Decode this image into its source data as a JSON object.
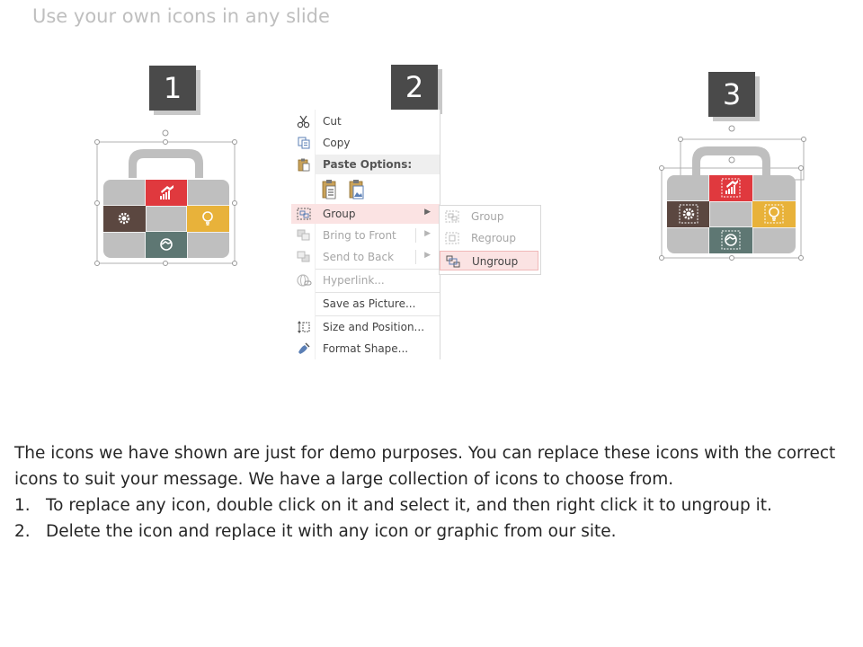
{
  "slide": {
    "title": "Use your own icons in any slide"
  },
  "steps": [
    {
      "label": "1"
    },
    {
      "label": "2"
    },
    {
      "label": "3"
    }
  ],
  "colors": {
    "case_gray": "#bfbfbf",
    "red": "#e0393e",
    "brown": "#5b4740",
    "yellow": "#e8b23a",
    "teal": "#5e7773",
    "badge": "#4a4a4a",
    "menu_highlight": "#fbe3e3"
  },
  "tile_icons": {
    "red": "chart-up-icon",
    "brown": "gear-icon",
    "yellow": "lightbulb-icon",
    "teal": "handshake-icon"
  },
  "context_menu": {
    "items": [
      {
        "label": "Cut",
        "icon": "scissors-icon"
      },
      {
        "label": "Copy",
        "icon": "copy-icon"
      },
      {
        "label": "Paste Options:",
        "icon": "clipboard-icon"
      },
      {
        "label": "Group",
        "icon": "group-icon"
      },
      {
        "label": "Bring to Front",
        "icon": "bring-front-icon"
      },
      {
        "label": "Send to Back",
        "icon": "send-back-icon"
      },
      {
        "label": "Hyperlink...",
        "icon": "link-icon"
      },
      {
        "label": "Save as Picture..."
      },
      {
        "label": "Size and Position...",
        "icon": "size-icon"
      },
      {
        "label": "Format Shape...",
        "icon": "paint-icon"
      }
    ],
    "submenu": [
      {
        "label": "Group",
        "icon": "group-icon"
      },
      {
        "label": "Regroup",
        "icon": "regroup-icon"
      },
      {
        "label": "Ungroup",
        "icon": "ungroup-icon"
      }
    ]
  },
  "body": {
    "intro": "The icons we have shown are just for demo purposes. You can replace these icons with the correct icons to suit your message. We have a large collection of icons to choose from.",
    "steps": [
      {
        "num": "1.",
        "text": "To replace any icon, double click on it and select it, and then right click it to ungroup it."
      },
      {
        "num": "2.",
        "text": "Delete the icon and replace it with any icon or graphic from our site."
      }
    ]
  }
}
